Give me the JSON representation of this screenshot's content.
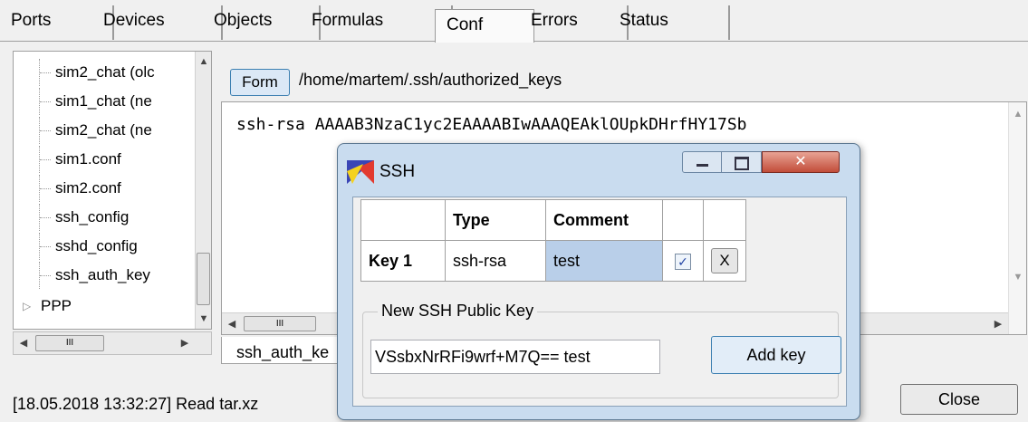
{
  "tabs": [
    "Ports",
    "Devices",
    "Objects",
    "Formulas",
    "Conf",
    "Errors",
    "Status"
  ],
  "active_tab": "Conf",
  "tree": {
    "items": [
      "sim2_chat (olc",
      "sim1_chat (ne",
      "sim2_chat (ne",
      "sim1.conf",
      "sim2.conf",
      "ssh_config",
      "sshd_config",
      "ssh_auth_key",
      "PPP"
    ]
  },
  "editor": {
    "form_button": "Form",
    "file_path": "/home/martem/.ssh/authorized_keys",
    "content": "ssh-rsa AAAAB3NzaC1yc2EAAAABIwAAAQEAklOUpkDHrfHY17Sb",
    "subtab": "ssh_auth_ke"
  },
  "status": {
    "message": "[18.05.2018 13:32:27] Read tar.xz",
    "close_button": "Close"
  },
  "dialog": {
    "title": "SSH",
    "table": {
      "headers": [
        "",
        "Type",
        "Comment",
        "",
        ""
      ],
      "rows": [
        {
          "name": "Key 1",
          "type": "ssh-rsa",
          "comment": "test",
          "checked": true,
          "remove": "X"
        }
      ]
    },
    "new_key_group": "New SSH Public Key",
    "new_key_value": "VSsbxNrRFi9wrf+M7Q== test",
    "add_button": "Add key"
  },
  "colors": {
    "dialog_frame": "#c9dcef",
    "selected_cell": "#b9cfe9",
    "close_red": "#c24d3a"
  }
}
